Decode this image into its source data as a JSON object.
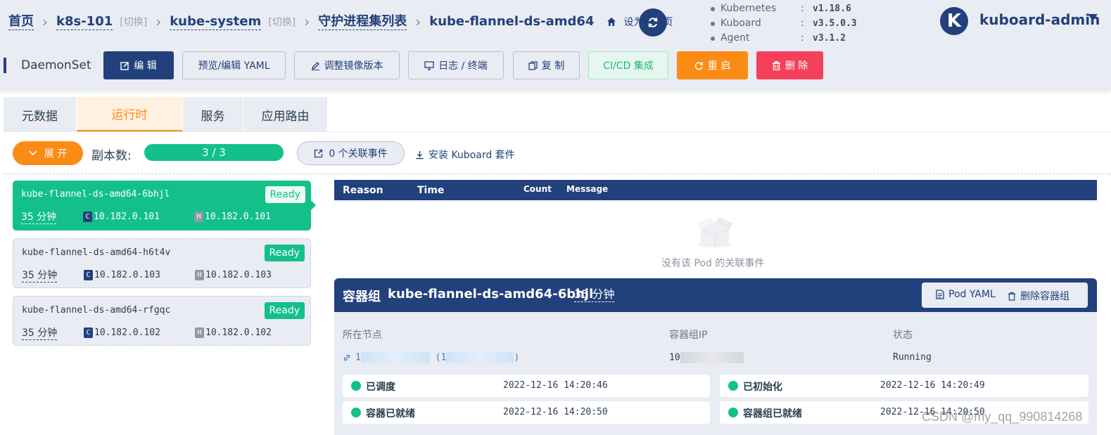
{
  "breadcrumb": {
    "home": "首页",
    "cluster": "k8s-101",
    "cluster_switch": "[切换]",
    "namespace": "kube-system",
    "namespace_switch": "[切换]",
    "list": "守护进程集列表",
    "current": "kube-flannel-ds-amd64",
    "set_default": "设为默认页"
  },
  "versions": [
    {
      "name": "Kubernetes",
      "value": "v1.18.6"
    },
    {
      "name": "Kuboard",
      "value": "v3.5.0.3"
    },
    {
      "name": "Agent",
      "value": "v3.1.2"
    }
  ],
  "user": {
    "avatar_letter": "K",
    "name": "kuboard-admin"
  },
  "kind": "DaemonSet",
  "actions": {
    "edit": "编 辑",
    "preview_yaml": "预览/编辑 YAML",
    "adjust_image": "调整镜像版本",
    "logs": "日志 / 终端",
    "copy": "复 制",
    "cicd": "CI/CD 集成",
    "restart": "重 启",
    "delete": "删 除"
  },
  "tabs": [
    "元数据",
    "运行时",
    "服务",
    "应用路由"
  ],
  "active_tab": "运行时",
  "toolbar": {
    "expand": "展 开",
    "replica_label": "副本数:",
    "replica_value": "3 / 3",
    "events": "0 个关联事件",
    "install": "安装 Kuboard 套件"
  },
  "pods": [
    {
      "name": "kube-flannel-ds-amd64-6bhjl",
      "status": "Ready",
      "age": "35 分钟",
      "c_tag": "C",
      "h_tag": "H",
      "container_ip": "10.182.0.101",
      "host_ip": "10.182.0.101"
    },
    {
      "name": "kube-flannel-ds-amd64-h6t4v",
      "status": "Ready",
      "age": "35 分钟",
      "c_tag": "C",
      "h_tag": "H",
      "container_ip": "10.182.0.103",
      "host_ip": "10.182.0.103"
    },
    {
      "name": "kube-flannel-ds-amd64-rfgqc",
      "status": "Ready",
      "age": "35 分钟",
      "c_tag": "C",
      "h_tag": "H",
      "container_ip": "10.182.0.102",
      "host_ip": "10.182.0.102"
    }
  ],
  "events_table": {
    "columns": [
      "Reason",
      "Time",
      "Count",
      "Message"
    ],
    "empty_text": "没有该 Pod 的关联事件"
  },
  "pod_detail": {
    "title": "容器组",
    "pod_name": "kube-flannel-ds-amd64-6bhjl",
    "age": "35 分钟",
    "pod_yaml": "Pod YAML",
    "delete_pod": "删除容器组",
    "node_label": "所在节点",
    "node_prefix": "1",
    "node_open": " (1",
    "node_close": ")",
    "pod_ip_label": "容器组IP",
    "pod_ip_prefix": "10",
    "state_label": "状态",
    "state_value": "Running",
    "conditions": [
      {
        "label": "已调度",
        "time": "2022-12-16 14:20:46"
      },
      {
        "label": "已初始化",
        "time": "2022-12-16 14:20:49"
      },
      {
        "label": "容器已就绪",
        "time": "2022-12-16 14:20:50"
      },
      {
        "label": "容器组已就绪",
        "time": "2022-12-16 14:20:50"
      }
    ]
  },
  "watermark": "CSDN @my_qq_990814268"
}
